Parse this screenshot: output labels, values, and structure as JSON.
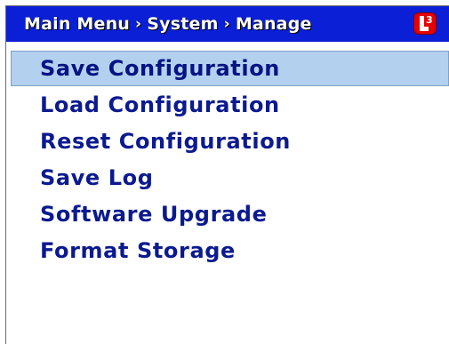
{
  "header": {
    "breadcrumb": [
      "Main Menu",
      "System",
      "Manage"
    ],
    "separator": "›",
    "logo_text": "3"
  },
  "menu": {
    "selected_index": 0,
    "items": [
      {
        "label": "Save Configuration"
      },
      {
        "label": "Load Configuration"
      },
      {
        "label": "Reset Configuration"
      },
      {
        "label": "Save Log"
      },
      {
        "label": "Software Upgrade"
      },
      {
        "label": "Format Storage"
      }
    ]
  },
  "colors": {
    "title_bar": "#0a1fd6",
    "selection": "#b3d0ee",
    "menu_text": "#0b1a8f",
    "logo": "#e60000"
  }
}
